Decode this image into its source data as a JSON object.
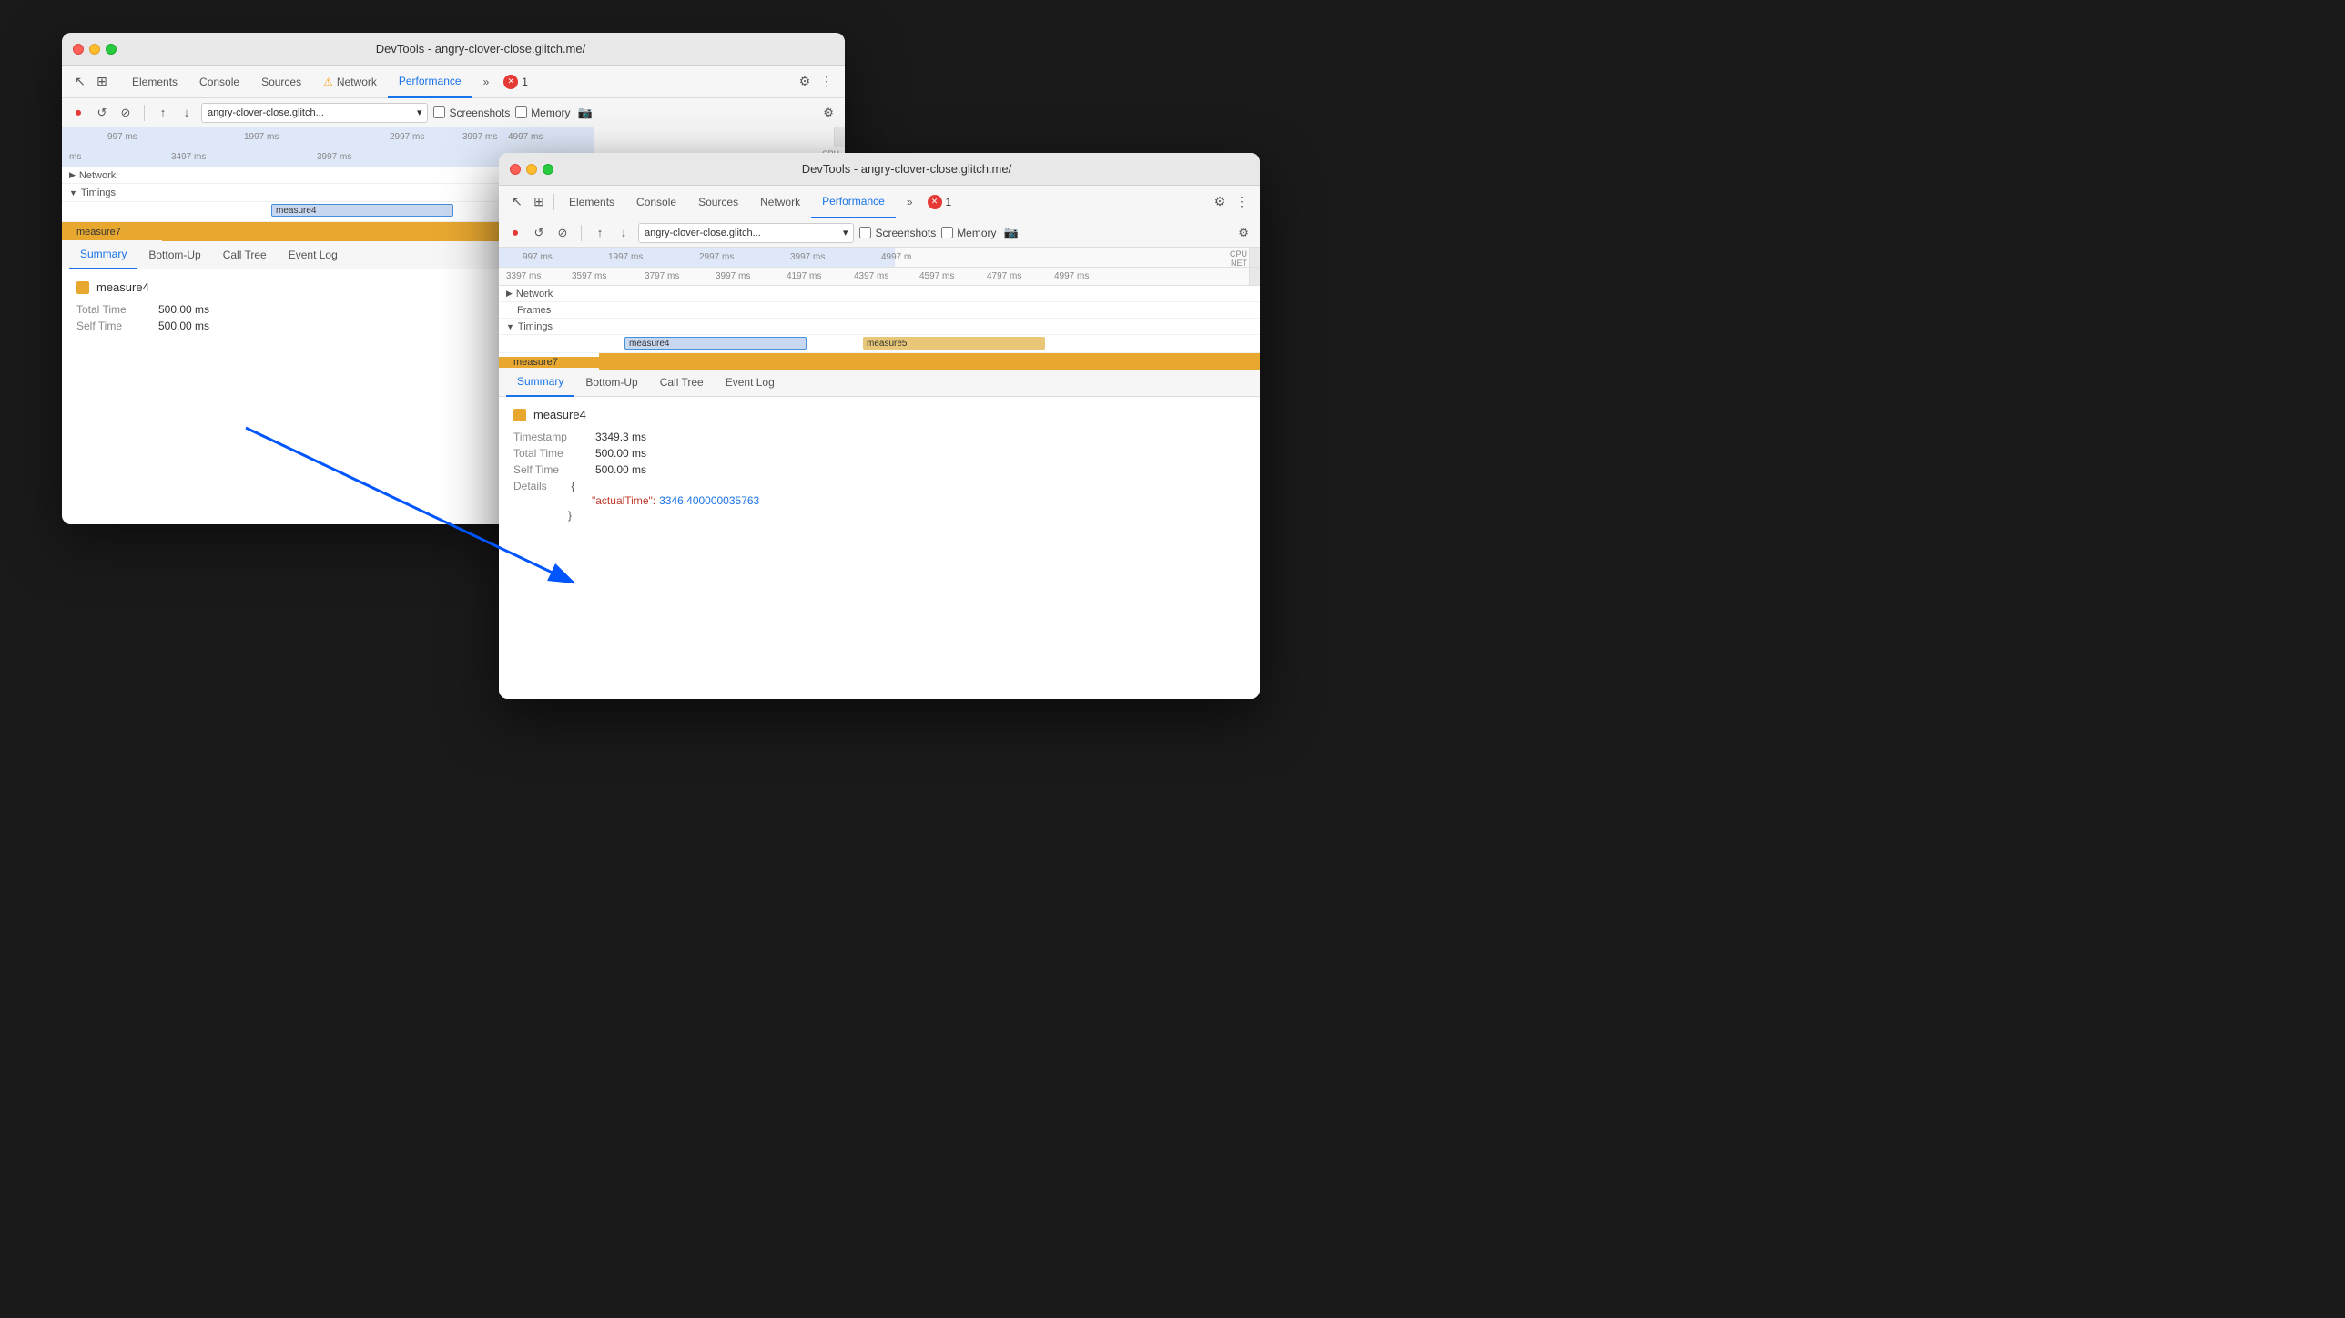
{
  "back_window": {
    "title": "DevTools - angry-clover-close.glitch.me/",
    "tabs": [
      "Elements",
      "Console",
      "Sources",
      "Network",
      "Performance",
      ">>",
      "1"
    ],
    "active_tab": "Performance",
    "url": "angry-clover-close.glitch...",
    "checkboxes": [
      "Screenshots",
      "Memory"
    ],
    "ruler_ticks_back": [
      "997 ms",
      "1997 ms",
      "2997 ms"
    ],
    "ruler_ticks_back2": [
      "ms",
      "3497 ms",
      "3997 ms"
    ],
    "tracks": {
      "network_label": "Network",
      "timings_label": "Timings",
      "measure4_label": "measure4",
      "measure7_label": "measure7"
    },
    "bottom_tabs": [
      "Summary",
      "Bottom-Up",
      "Call Tree",
      "Event Log"
    ],
    "active_bottom_tab": "Summary",
    "summary": {
      "title": "measure4",
      "total_time_label": "Total Time",
      "total_time_value": "500.00 ms",
      "self_time_label": "Self Time",
      "self_time_value": "500.00 ms"
    }
  },
  "front_window": {
    "title": "DevTools - angry-clover-close.glitch.me/",
    "tabs": [
      "Elements",
      "Console",
      "Sources",
      "Network",
      "Performance",
      ">>",
      "1"
    ],
    "active_tab": "Performance",
    "url": "angry-clover-close.glitch...",
    "checkboxes": [
      "Screenshots",
      "Memory"
    ],
    "ruler_ticks1": [
      "997 ms",
      "1997 ms",
      "2997 ms",
      "3997 ms",
      "4997 m"
    ],
    "ruler_ticks2": [
      "3397 ms",
      "3597 ms",
      "3797 ms",
      "3997 ms",
      "4197 ms",
      "4397 ms",
      "4597 ms",
      "4797 ms",
      "4997 ms"
    ],
    "tracks": {
      "frames_label": "Frames",
      "timings_label": "Timings",
      "measure4_label": "measure4",
      "measure5_label": "measure5",
      "measure7_label": "measure7"
    },
    "bottom_tabs": [
      "Summary",
      "Bottom-Up",
      "Call Tree",
      "Event Log"
    ],
    "active_bottom_tab": "Summary",
    "summary": {
      "title": "measure4",
      "timestamp_label": "Timestamp",
      "timestamp_value": "3349.3 ms",
      "total_time_label": "Total Time",
      "total_time_value": "500.00 ms",
      "self_time_label": "Self Time",
      "self_time_value": "500.00 ms",
      "details_label": "Details",
      "details_open_brace": "{",
      "details_key": "\"actualTime\":",
      "details_val": "3346.400000035763",
      "details_close_brace": "}"
    }
  },
  "arrow": {
    "color": "#0055ff"
  },
  "icons": {
    "record": "⏺",
    "reload": "↺",
    "cancel": "⊘",
    "upload": "↑",
    "download": "↓",
    "settings": "⚙",
    "more": "⋮",
    "cursor": "↖",
    "layout": "⊞",
    "close_red": "✕",
    "chevron_down": "▼",
    "triangle_right": "▶",
    "cpu_upload": "↑",
    "screenshot": "📷"
  }
}
